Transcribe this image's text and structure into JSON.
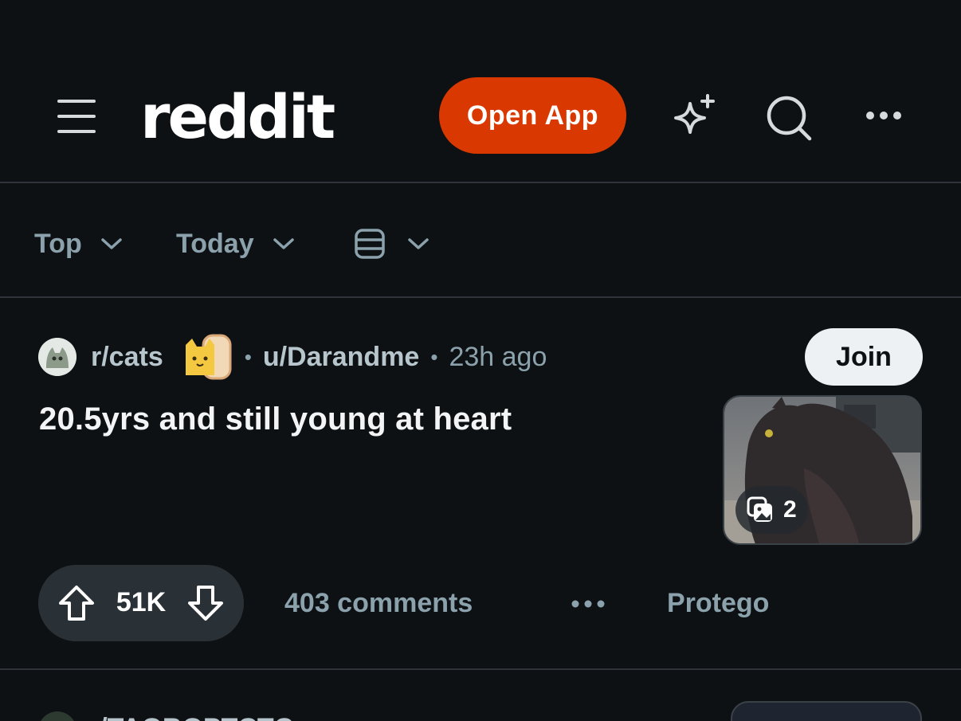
{
  "header": {
    "logo": "reddit",
    "open_app_label": "Open App",
    "icons": [
      "menu-icon",
      "sparkle-icon",
      "search-icon",
      "more-icon"
    ]
  },
  "sortbar": {
    "sort_label": "Top",
    "time_label": "Today",
    "view_icon": "card-view-icon"
  },
  "post": {
    "subreddit": "r/cats",
    "user": "u/Darandme",
    "time": "23h ago",
    "join_label": "Join",
    "title": "20.5yrs and still young at heart",
    "gallery_count": "2",
    "score": "51K",
    "comments_label": "403 comments",
    "award_label": "Protego"
  },
  "next_post": {
    "subreddit": "r/TAOBOPTCTC"
  },
  "colors": {
    "background": "#0e1113",
    "accent": "#d93900",
    "muted_text": "#8ba2ad",
    "pill": "#2a3136"
  }
}
